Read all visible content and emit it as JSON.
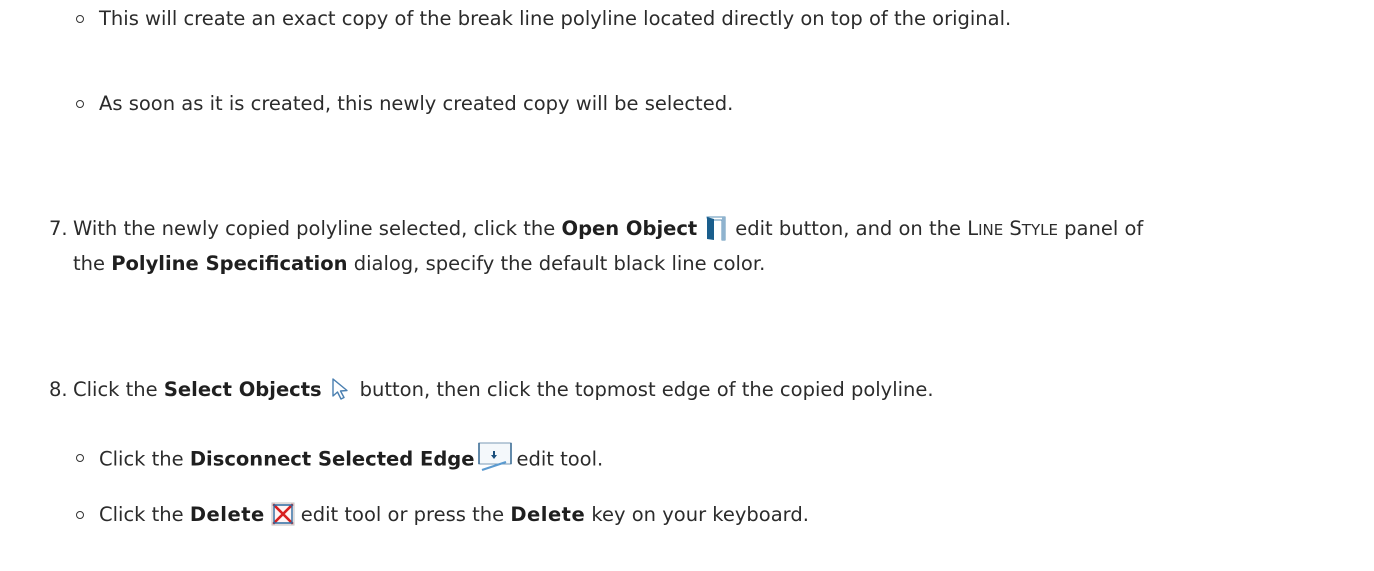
{
  "doc": {
    "b1": {
      "text": "This will create an exact copy of the break line polyline located directly on top of the original."
    },
    "b2": {
      "text": "As soon as it is created, this newly created copy will be selected."
    },
    "s7": {
      "num": "7.",
      "a": "With the newly copied polyline selected, click the",
      "bold1": "Open Object",
      "b": "edit button, and on the",
      "sc1a": "L",
      "sc1b": "INE",
      "sc2a": "S",
      "sc2b": "TYLE",
      "c": "panel of",
      "d": "the",
      "bold2": "Polyline Specification",
      "e": "dialog, specify the default black line color."
    },
    "s8": {
      "num": "8.",
      "a": "Click the",
      "bold1": "Select Objects",
      "b": "button, then click the topmost edge of the copied polyline."
    },
    "b3": {
      "a": "Click the",
      "bold1": "Disconnect Selected Edge",
      "b": "edit tool."
    },
    "b4": {
      "a": "Click the",
      "bold1": "Delete",
      "b": "edit tool or press the",
      "bold2": "Delete",
      "c": "key on your keyboard."
    }
  },
  "icons": {
    "open_object": "open-object-icon",
    "select_objects": "select-objects-arrow-icon",
    "disconnect_edge": "disconnect-selected-edge-icon",
    "delete": "delete-x-icon"
  },
  "colors": {
    "text": "#2b2b2b",
    "icon_blue": "#1a5e8c",
    "delete_red": "#d82020"
  }
}
